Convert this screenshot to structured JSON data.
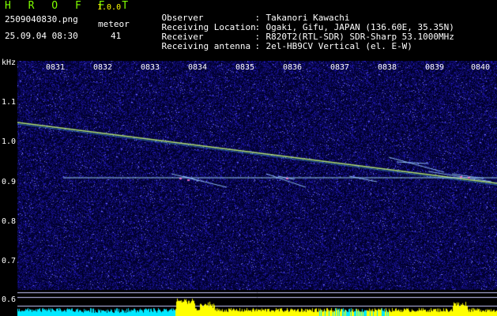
{
  "header": {
    "app_name": "H R O F F T",
    "version": "1.0.0",
    "filename": "2509040830.png",
    "meteor_label": "meteor",
    "datetime": "25.09.04 08:30",
    "meteor_count": "41"
  },
  "info": [
    {
      "label": "Observer",
      "value": "Takanori Kawachi"
    },
    {
      "label": "Receiving Location",
      "value": "Ogaki, Gifu, JAPAN (136.60E, 35.35N)"
    },
    {
      "label": "Receiver",
      "value": "R820T2(RTL-SDR) SDR-Sharp 53.1000MHz"
    },
    {
      "label": "Receiving antenna",
      "value": "2el-HB9CV Vertical (el. E-W)"
    }
  ],
  "colon": ":",
  "axis": {
    "unit": "kHz",
    "y_labels": [
      "1.1",
      "1.0",
      "0.9",
      "0.8",
      "0.7",
      "0.6"
    ],
    "y_values": [
      1.1,
      1.0,
      0.9,
      0.8,
      0.7,
      0.6
    ],
    "x_labels": [
      "0831",
      "0832",
      "0833",
      "0834",
      "0835",
      "0836",
      "0837",
      "0838",
      "0839",
      "0840"
    ]
  },
  "colors": {
    "background": "#000000",
    "title": "#7fff00",
    "version": "#ffff00",
    "noise": "#1a1aa0",
    "echo_line": "#d8ff60",
    "carrier": "#a0e0ff",
    "histogram_yellow": "#ffff00",
    "histogram_cyan": "#00ffff"
  }
}
